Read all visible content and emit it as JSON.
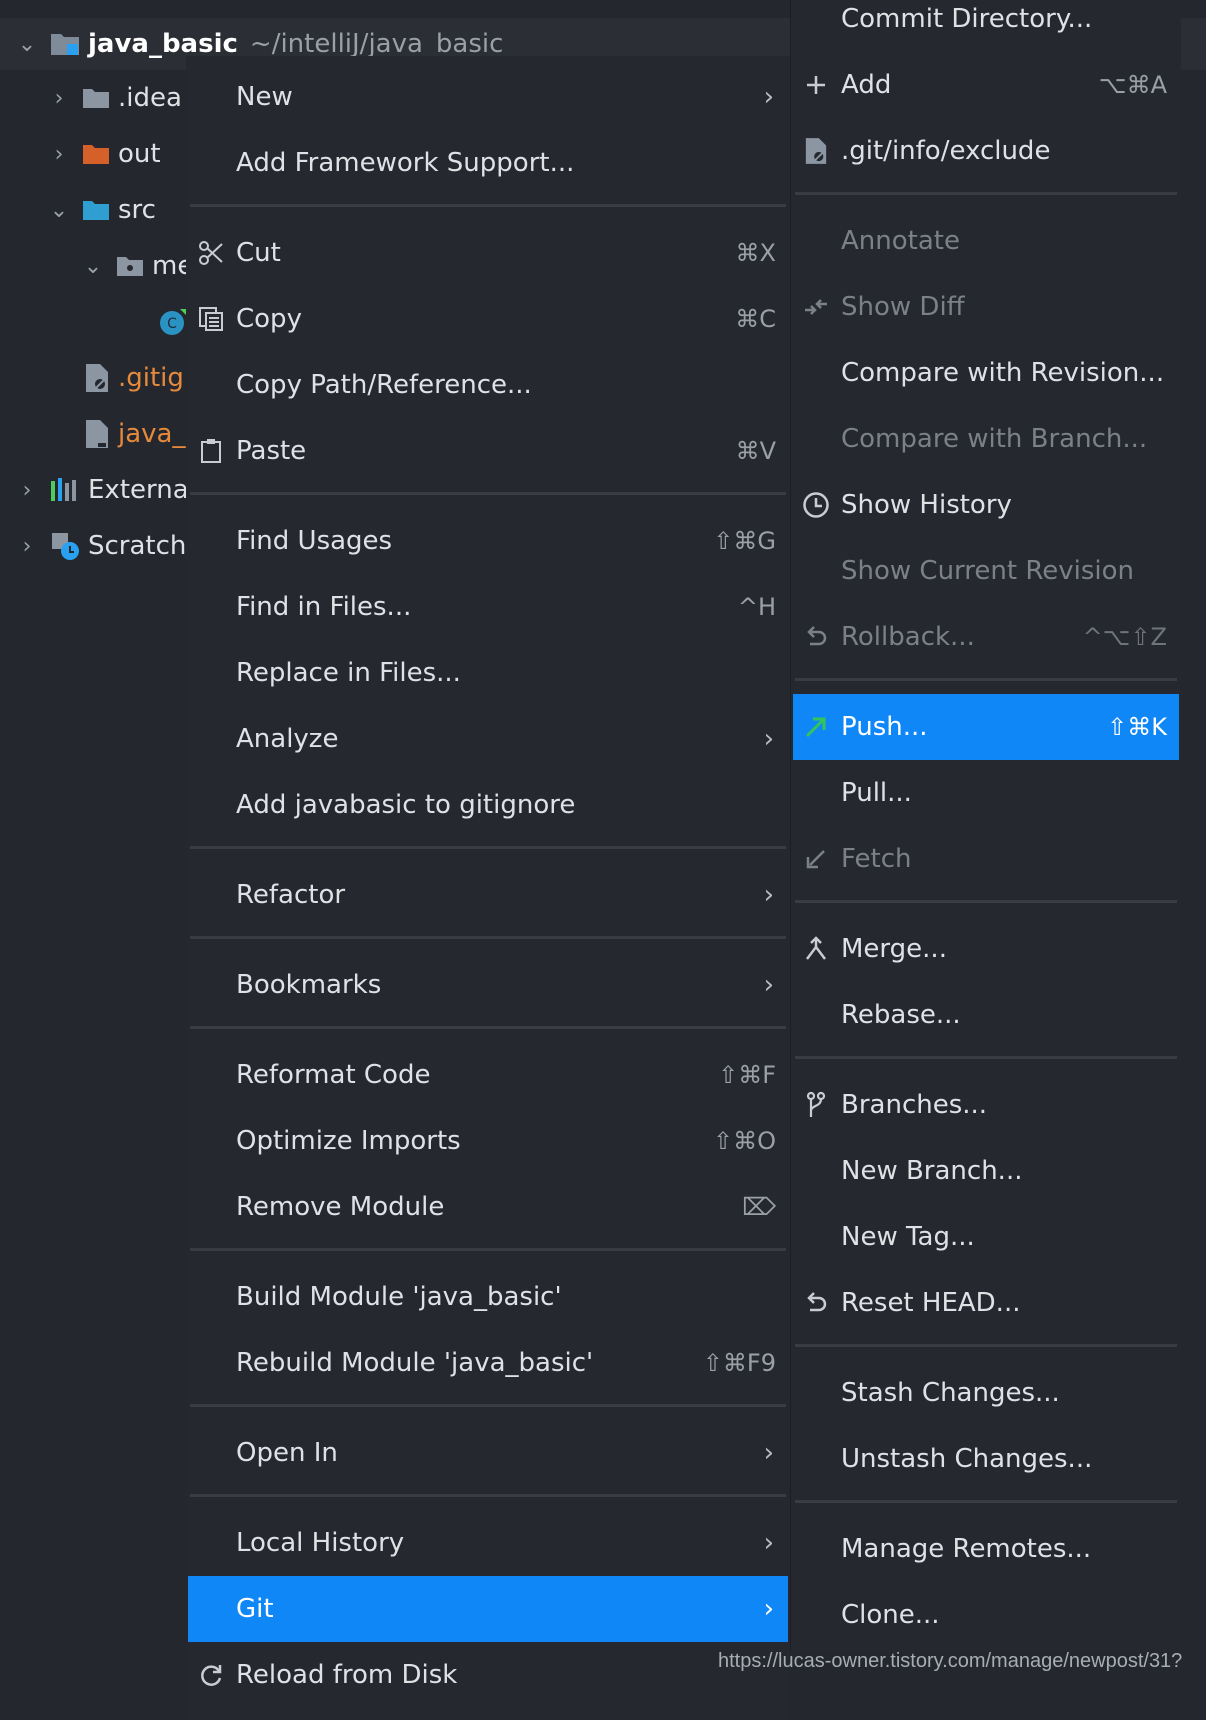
{
  "tree": {
    "root": {
      "name": "java_basic",
      "path": "~/intelliJ/java_basic"
    },
    "items": [
      {
        "label": ".idea",
        "color": "#dfe1e5"
      },
      {
        "label": "out",
        "color": "#dfe1e5"
      },
      {
        "label": "src",
        "color": "#dfe1e5"
      },
      {
        "label": "me",
        "color": "#dfe1e5"
      },
      {
        "label": ".gitig",
        "color": "#e58a3c"
      },
      {
        "label": "java_",
        "color": "#e58a3c"
      },
      {
        "label": "External",
        "color": "#dfe1e5"
      },
      {
        "label": "Scratch",
        "color": "#dfe1e5"
      }
    ]
  },
  "context_menu": {
    "items": [
      {
        "label": "New",
        "submenu": true
      },
      {
        "label": "Add Framework Support..."
      },
      {
        "label": "Cut",
        "icon": "scissors-icon",
        "shortcut": "⌘X"
      },
      {
        "label": "Copy",
        "icon": "copy-icon",
        "shortcut": "⌘C"
      },
      {
        "label": "Copy Path/Reference..."
      },
      {
        "label": "Paste",
        "icon": "clipboard-icon",
        "shortcut": "⌘V"
      },
      {
        "label": "Find Usages",
        "shortcut": "⇧⌘G"
      },
      {
        "label": "Find in Files...",
        "shortcut": "^H"
      },
      {
        "label": "Replace in Files..."
      },
      {
        "label": "Analyze",
        "submenu": true
      },
      {
        "label": "Add javabasic to gitignore"
      },
      {
        "label": "Refactor",
        "submenu": true
      },
      {
        "label": "Bookmarks",
        "submenu": true
      },
      {
        "label": "Reformat Code",
        "shortcut": "⇧⌘F"
      },
      {
        "label": "Optimize Imports",
        "shortcut": "⇧⌘O"
      },
      {
        "label": "Remove Module",
        "shortcut": "⌦"
      },
      {
        "label": "Build Module 'java_basic'"
      },
      {
        "label": "Rebuild Module 'java_basic'",
        "shortcut": "⇧⌘F9"
      },
      {
        "label": "Open In",
        "submenu": true
      },
      {
        "label": "Local History",
        "submenu": true
      },
      {
        "label": "Git",
        "submenu": true,
        "selected": true
      },
      {
        "label": "Reload from Disk",
        "icon": "reload-icon"
      }
    ]
  },
  "git_submenu": {
    "items": [
      {
        "label": "Commit Directory..."
      },
      {
        "label": "Add",
        "icon": "plus-icon",
        "shortcut": "⌥⌘A"
      },
      {
        "label": ".git/info/exclude",
        "icon": "ignore-file-icon"
      },
      {
        "label": "Annotate",
        "disabled": true
      },
      {
        "label": "Show Diff",
        "icon": "diff-icon",
        "disabled": true
      },
      {
        "label": "Compare with Revision..."
      },
      {
        "label": "Compare with Branch...",
        "disabled": true
      },
      {
        "label": "Show History",
        "icon": "clock-icon"
      },
      {
        "label": "Show Current Revision",
        "disabled": true
      },
      {
        "label": "Rollback...",
        "icon": "undo-icon",
        "shortcut": "^⌥⇧Z",
        "disabled": true
      },
      {
        "label": "Push...",
        "icon": "push-arrow-icon",
        "shortcut": "⇧⌘K",
        "selected": true
      },
      {
        "label": "Pull..."
      },
      {
        "label": "Fetch",
        "icon": "fetch-icon",
        "disabled": true
      },
      {
        "label": "Merge...",
        "icon": "merge-icon"
      },
      {
        "label": "Rebase..."
      },
      {
        "label": "Branches...",
        "icon": "branch-icon"
      },
      {
        "label": "New Branch..."
      },
      {
        "label": "New Tag..."
      },
      {
        "label": "Reset HEAD...",
        "icon": "undo-icon"
      },
      {
        "label": "Stash Changes..."
      },
      {
        "label": "Unstash Changes..."
      },
      {
        "label": "Manage Remotes..."
      },
      {
        "label": "Clone..."
      }
    ]
  },
  "watermark": "https://lucas-owner.tistory.com/manage/newpost/31?",
  "colors": {
    "selection": "#0f87f6",
    "menu_bg": "#25282e",
    "background": "#24272d",
    "ignored_file": "#e58a3c"
  }
}
